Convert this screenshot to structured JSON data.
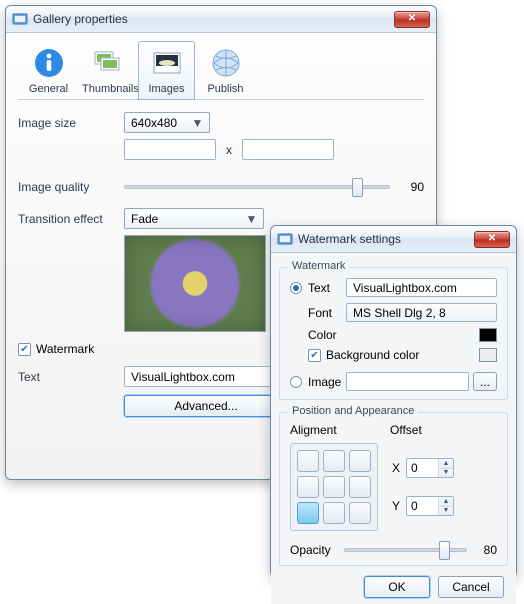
{
  "main": {
    "title": "Gallery properties",
    "tabs": [
      {
        "label": "General"
      },
      {
        "label": "Thumbnails"
      },
      {
        "label": "Images"
      },
      {
        "label": "Publish"
      }
    ],
    "labels": {
      "imageSize": "Image size",
      "imageQuality": "Image quality",
      "transitionEffect": "Transition effect",
      "watermark": "Watermark",
      "text": "Text",
      "advanced": "Advanced...",
      "dimSep": "x"
    },
    "values": {
      "imageSize": "640x480",
      "imageQuality": "90",
      "transitionEffect": "Fade",
      "watermarkText": "VisualLightbox.com"
    }
  },
  "dlg": {
    "title": "Watermark settings",
    "group1": "Watermark",
    "group2": "Position and Appearance",
    "labels": {
      "text": "Text",
      "font": "Font",
      "color": "Color",
      "bgcolor": "Background color",
      "image": "Image",
      "alignment": "Aligment",
      "offset": "Offset",
      "x": "X",
      "y": "Y",
      "opacity": "Opacity",
      "browse": "...",
      "ok": "OK",
      "cancel": "Cancel"
    },
    "values": {
      "textValue": "VisualLightbox.com",
      "fontValue": "MS Shell Dlg 2, 8",
      "x": "0",
      "y": "0",
      "opacity": "80"
    }
  }
}
